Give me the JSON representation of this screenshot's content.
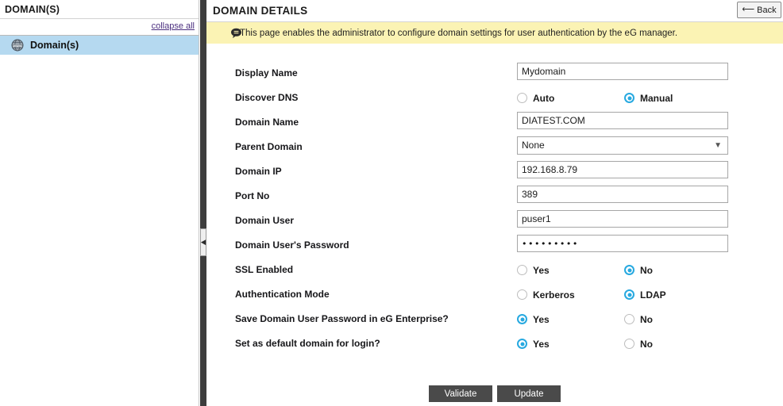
{
  "sidebar": {
    "header_title": "DOMAIN(S)",
    "collapse_all_label": "collapse all",
    "tree": [
      {
        "label": "Domain(s)",
        "icon": "globe-icon",
        "selected": true
      }
    ]
  },
  "splitter": {
    "handle_icon": "chevron-left-icon"
  },
  "main": {
    "page_title": "DOMAIN DETAILS",
    "back_button_label": "Back",
    "back_button_icon": "back-arrow-icon",
    "banner": {
      "icon": "comment-icon",
      "text": "This page enables the administrator to configure domain settings for user authentication by the eG manager."
    },
    "form": [
      {
        "label": "Display Name",
        "type": "text",
        "value": "Mydomain"
      },
      {
        "label": "Discover DNS",
        "type": "radio",
        "options": [
          {
            "label": "Auto",
            "checked": false
          },
          {
            "label": "Manual",
            "checked": true
          }
        ]
      },
      {
        "label": "Domain Name",
        "type": "text",
        "value": "DIATEST.COM"
      },
      {
        "label": "Parent Domain",
        "type": "select",
        "value": "None",
        "arrow": "chevron-down-icon"
      },
      {
        "label": "Domain IP",
        "type": "text",
        "value": "192.168.8.79"
      },
      {
        "label": "Port No",
        "type": "text",
        "value": "389"
      },
      {
        "label": "Domain User",
        "type": "text",
        "value": "puser1"
      },
      {
        "label": "Domain User's Password",
        "type": "password",
        "value": "•••••••••"
      },
      {
        "label": "SSL Enabled",
        "type": "radio",
        "options": [
          {
            "label": "Yes",
            "checked": false
          },
          {
            "label": "No",
            "checked": true
          }
        ]
      },
      {
        "label": "Authentication Mode",
        "type": "radio",
        "options": [
          {
            "label": "Kerberos",
            "checked": false
          },
          {
            "label": "LDAP",
            "checked": true
          }
        ]
      },
      {
        "label": "Save Domain User Password in eG Enterprise?",
        "type": "radio",
        "options": [
          {
            "label": "Yes",
            "checked": true
          },
          {
            "label": "No",
            "checked": false
          }
        ]
      },
      {
        "label": "Set as default domain for login?",
        "type": "radio",
        "options": [
          {
            "label": "Yes",
            "checked": true
          },
          {
            "label": "No",
            "checked": false
          }
        ]
      }
    ],
    "buttons": [
      {
        "label": "Validate",
        "name": "validate-button"
      },
      {
        "label": "Update",
        "name": "update-button"
      }
    ]
  },
  "colors": {
    "accent_blue": "#27a9e0",
    "banner_yellow": "#fbf3b4",
    "tree_selected": "#b5d9f0",
    "splitter_dark": "#3d3d3d",
    "button_dark": "#4a4a4a",
    "link_purple": "#4b2f7f"
  }
}
